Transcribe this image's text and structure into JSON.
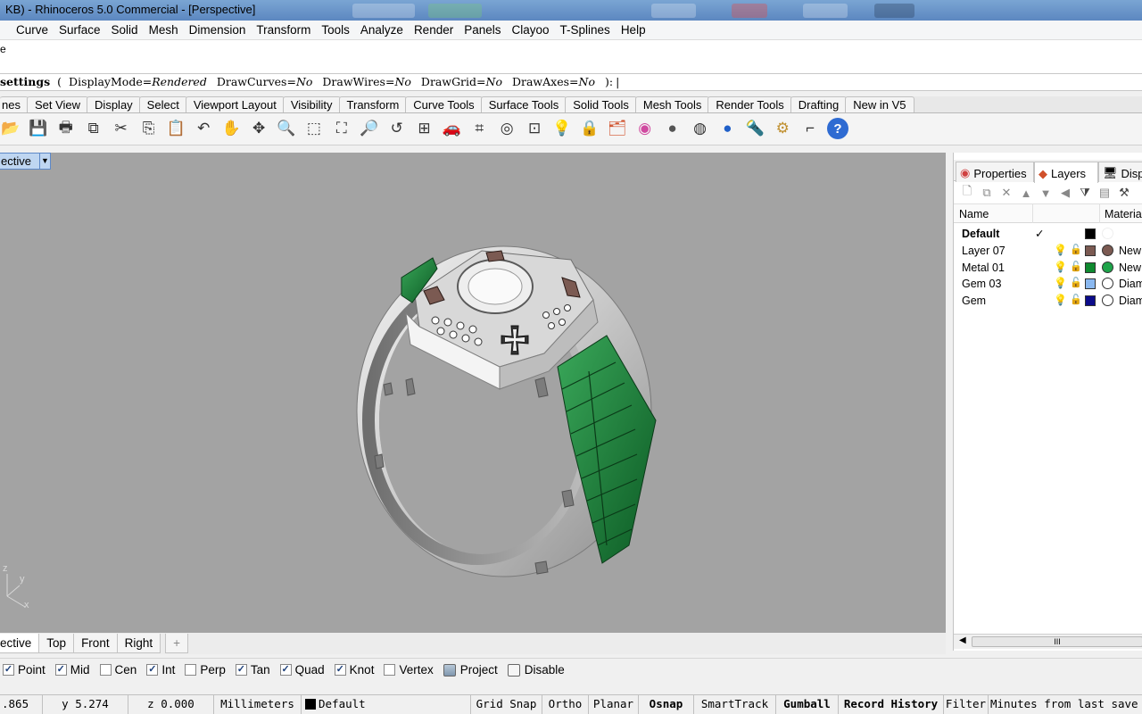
{
  "title": "KB) - Rhinoceros 5.0 Commercial - [Perspective]",
  "menu": [
    "Curve",
    "Surface",
    "Solid",
    "Mesh",
    "Dimension",
    "Transform",
    "Tools",
    "Analyze",
    "Render",
    "Panels",
    "Clayoo",
    "T-Splines",
    "Help"
  ],
  "history_text": "e",
  "command": {
    "name": "settings",
    "open": "(",
    "params": [
      {
        "key": "DisplayMode=",
        "val": "Rendered"
      },
      {
        "key": "DrawCurves=",
        "val": "No"
      },
      {
        "key": "DrawWires=",
        "val": "No"
      },
      {
        "key": "DrawGrid=",
        "val": "No"
      },
      {
        "key": "DrawAxes=",
        "val": "No"
      }
    ],
    "close": "):"
  },
  "toolbar_tabs": [
    "nes",
    "Set View",
    "Display",
    "Select",
    "Viewport Layout",
    "Visibility",
    "Transform",
    "Curve Tools",
    "Surface Tools",
    "Solid Tools",
    "Mesh Tools",
    "Render Tools",
    "Drafting",
    "New in V5"
  ],
  "tools": [
    {
      "name": "open-icon",
      "glyph": "📂"
    },
    {
      "name": "save-icon",
      "glyph": "💾"
    },
    {
      "name": "print-icon",
      "glyph": "🖶"
    },
    {
      "name": "export-icon",
      "glyph": "⧉"
    },
    {
      "name": "cut-icon",
      "glyph": "✂"
    },
    {
      "name": "copy-icon",
      "glyph": "⎘"
    },
    {
      "name": "paste-icon",
      "glyph": "📋"
    },
    {
      "name": "undo-icon",
      "glyph": "↶"
    },
    {
      "name": "pan-icon",
      "glyph": "✋"
    },
    {
      "name": "rotate-view-icon",
      "glyph": "✥"
    },
    {
      "name": "zoom-icon",
      "glyph": "🔍"
    },
    {
      "name": "zoom-window-icon",
      "glyph": "⬚"
    },
    {
      "name": "zoom-extents-icon",
      "glyph": "⛶"
    },
    {
      "name": "zoom-selected-icon",
      "glyph": "🔎"
    },
    {
      "name": "undo-view-icon",
      "glyph": "↺"
    },
    {
      "name": "four-view-icon",
      "glyph": "⊞"
    },
    {
      "name": "car-icon",
      "glyph": "🚗"
    },
    {
      "name": "grid-icon",
      "glyph": "⌗"
    },
    {
      "name": "target-icon",
      "glyph": "◎"
    },
    {
      "name": "osnap-icon",
      "glyph": "⊡"
    },
    {
      "name": "light-icon",
      "glyph": "💡"
    },
    {
      "name": "lock-icon",
      "glyph": "🔒"
    },
    {
      "name": "layer-icon",
      "glyph": "🗂"
    },
    {
      "name": "color-wheel-icon",
      "glyph": "◉"
    },
    {
      "name": "render-sphere-icon",
      "glyph": "●"
    },
    {
      "name": "material-sphere-icon",
      "glyph": "◍"
    },
    {
      "name": "blue-sphere-icon",
      "glyph": "●"
    },
    {
      "name": "spotlight-icon",
      "glyph": "🔦"
    },
    {
      "name": "settings-gear-icon",
      "glyph": "⚙"
    },
    {
      "name": "dimension-icon",
      "glyph": "⌐"
    },
    {
      "name": "help-icon",
      "glyph": "?"
    }
  ],
  "viewport": {
    "name": "ective",
    "axes": {
      "z": "z",
      "y": "y",
      "x": "x"
    }
  },
  "viewport_tabs": [
    "ective",
    "Top",
    "Front",
    "Right",
    "+"
  ],
  "osnaps": [
    {
      "label": "Point",
      "checked": true
    },
    {
      "label": "Mid",
      "checked": true
    },
    {
      "label": "Cen",
      "checked": false
    },
    {
      "label": "Int",
      "checked": true
    },
    {
      "label": "Perp",
      "checked": false
    },
    {
      "label": "Tan",
      "checked": true
    },
    {
      "label": "Quad",
      "checked": true
    },
    {
      "label": "Knot",
      "checked": true
    },
    {
      "label": "Vertex",
      "checked": false
    }
  ],
  "osnap_buttons": [
    {
      "label": "Project",
      "on": true
    },
    {
      "label": "Disable",
      "on": false
    }
  ],
  "status": {
    "x": ".865",
    "y": "y 5.274",
    "z": "z 0.000",
    "units": "Millimeters",
    "layer": "Default",
    "grid_snap": "Grid Snap",
    "ortho": "Ortho",
    "planar": "Planar",
    "osnap": "Osnap",
    "smarttrack": "SmartTrack",
    "gumball": "Gumball",
    "record_history": "Record History",
    "filter": "Filter",
    "minutes": "Minutes from last save:"
  },
  "panel": {
    "tabs": [
      "Properties",
      "Layers",
      "Displ"
    ],
    "columns": {
      "name": "Name",
      "material": "Material"
    },
    "layers": [
      {
        "name": "Default",
        "current": true,
        "check": "✓",
        "color": "#000000",
        "material": "",
        "material_color": "#ffffff"
      },
      {
        "name": "Layer 07",
        "current": false,
        "check": "",
        "color": "#7b5a52",
        "material": "New",
        "material_color": "#7b5a52"
      },
      {
        "name": "Metal 01",
        "current": false,
        "check": "",
        "color": "#0f8a2f",
        "material": "New",
        "material_color": "#1ea44a"
      },
      {
        "name": "Gem 03",
        "current": false,
        "check": "",
        "color": "#8ab8f0",
        "material": "Diam",
        "material_color": "#ffffff"
      },
      {
        "name": "Gem",
        "current": false,
        "check": "",
        "color": "#0b0b8a",
        "material": "Diam",
        "material_color": "#ffffff"
      }
    ],
    "scroll_grip": "III"
  }
}
